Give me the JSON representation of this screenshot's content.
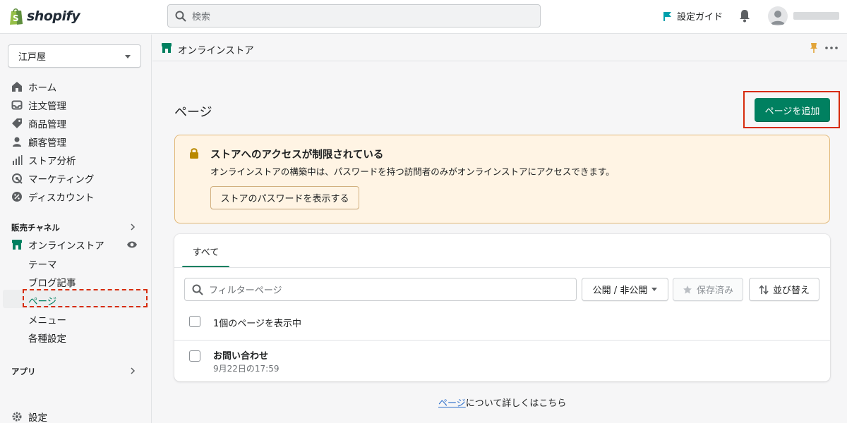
{
  "topbar": {
    "logo_text": "shopify",
    "search_placeholder": "検索",
    "setup_guide": "設定ガイド"
  },
  "sidebar": {
    "store_name": "江戸屋",
    "nav": [
      {
        "label": "ホーム",
        "icon": "home-icon"
      },
      {
        "label": "注文管理",
        "icon": "inbox-icon"
      },
      {
        "label": "商品管理",
        "icon": "tag-icon"
      },
      {
        "label": "顧客管理",
        "icon": "person-icon"
      },
      {
        "label": "ストア分析",
        "icon": "bar-chart-icon"
      },
      {
        "label": "マーケティング",
        "icon": "target-icon"
      },
      {
        "label": "ディスカウント",
        "icon": "discount-icon"
      }
    ],
    "sales_channels_title": "販売チャネル",
    "online_store_label": "オンラインストア",
    "sub_items": [
      "テーマ",
      "ブログ記事",
      "ページ",
      "メニュー",
      "各種設定"
    ],
    "apps_title": "アプリ",
    "settings_label": "設定"
  },
  "breadcrumb": {
    "label": "オンラインストア"
  },
  "page": {
    "title": "ページ",
    "add_button": "ページを追加"
  },
  "banner": {
    "title": "ストアへのアクセスが制限されている",
    "body": "オンラインストアの構築中は、パスワードを持つ訪問者のみがオンラインストアにアクセスできます。",
    "button": "ストアのパスワードを表示する"
  },
  "list": {
    "tab_all": "すべて",
    "filter_placeholder": "フィルターページ",
    "visibility_button": "公開 / 非公開",
    "saved_button": "保存済み",
    "sort_button": "並び替え",
    "count_text": "1個のページを表示中",
    "rows": [
      {
        "title": "お問い合わせ",
        "subtitle": "9月22日の17:59"
      }
    ]
  },
  "footer": {
    "link": "ページ",
    "text": "について詳しくはこちら"
  },
  "colors": {
    "primary": "#008060",
    "highlight": "#d72c0d",
    "banner_bg": "#fff4e4",
    "link": "#2c6ecb"
  }
}
